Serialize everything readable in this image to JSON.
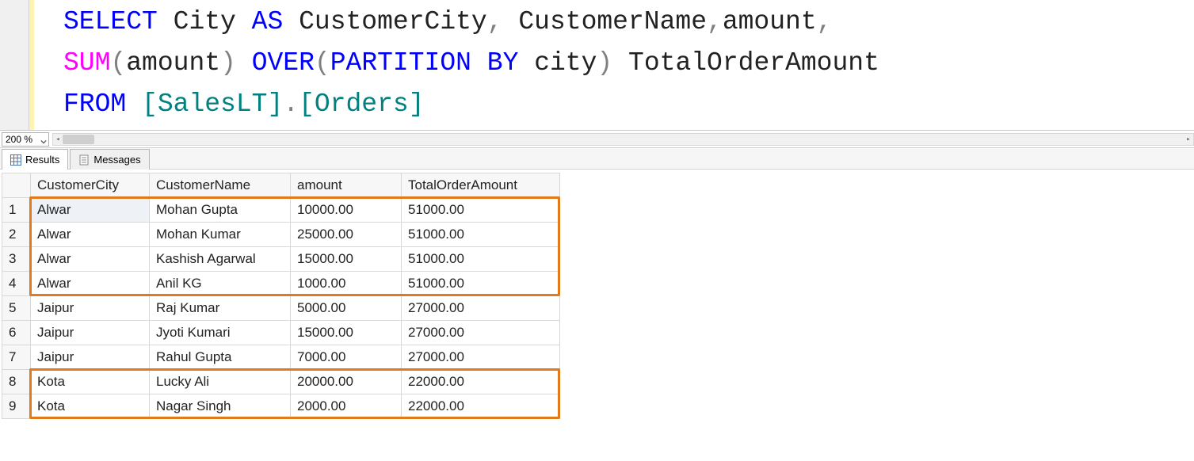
{
  "editor": {
    "tokens": [
      [
        {
          "t": "SELECT",
          "c": "kw-blue"
        },
        {
          "t": " ",
          "c": ""
        },
        {
          "t": "City",
          "c": "ident"
        },
        {
          "t": " ",
          "c": ""
        },
        {
          "t": "AS",
          "c": "kw-blue"
        },
        {
          "t": " ",
          "c": ""
        },
        {
          "t": "CustomerCity",
          "c": "ident"
        },
        {
          "t": ",",
          "c": "kw-gray"
        },
        {
          "t": " ",
          "c": ""
        },
        {
          "t": "CustomerName",
          "c": "ident"
        },
        {
          "t": ",",
          "c": "kw-gray"
        },
        {
          "t": "amount",
          "c": "ident"
        },
        {
          "t": ",",
          "c": "kw-gray"
        }
      ],
      [
        {
          "t": "SUM",
          "c": "kw-pink"
        },
        {
          "t": "(",
          "c": "kw-gray"
        },
        {
          "t": "amount",
          "c": "ident"
        },
        {
          "t": ")",
          "c": "kw-gray"
        },
        {
          "t": " ",
          "c": ""
        },
        {
          "t": "OVER",
          "c": "kw-blue"
        },
        {
          "t": "(",
          "c": "kw-gray"
        },
        {
          "t": "PARTITION",
          "c": "kw-blue"
        },
        {
          "t": " ",
          "c": ""
        },
        {
          "t": "BY",
          "c": "kw-blue"
        },
        {
          "t": " ",
          "c": ""
        },
        {
          "t": "city",
          "c": "ident"
        },
        {
          "t": ")",
          "c": "kw-gray"
        },
        {
          "t": " ",
          "c": ""
        },
        {
          "t": "TotalOrderAmount",
          "c": "ident"
        }
      ],
      [
        {
          "t": "FROM",
          "c": "kw-blue"
        },
        {
          "t": " ",
          "c": ""
        },
        {
          "t": "[SalesLT]",
          "c": "kw-teal"
        },
        {
          "t": ".",
          "c": "kw-gray"
        },
        {
          "t": "[Orders]",
          "c": "kw-teal"
        }
      ]
    ]
  },
  "zoom": {
    "value": "200 %"
  },
  "tabs": {
    "results": "Results",
    "messages": "Messages"
  },
  "grid": {
    "columns": [
      "CustomerCity",
      "CustomerName",
      "amount",
      "TotalOrderAmount"
    ],
    "rows": [
      {
        "n": "1",
        "city": "Alwar",
        "name": "Mohan Gupta",
        "amount": "10000.00",
        "total": "51000.00"
      },
      {
        "n": "2",
        "city": "Alwar",
        "name": "Mohan Kumar",
        "amount": "25000.00",
        "total": "51000.00"
      },
      {
        "n": "3",
        "city": "Alwar",
        "name": "Kashish Agarwal",
        "amount": "15000.00",
        "total": "51000.00"
      },
      {
        "n": "4",
        "city": "Alwar",
        "name": "Anil KG",
        "amount": "1000.00",
        "total": "51000.00"
      },
      {
        "n": "5",
        "city": "Jaipur",
        "name": "Raj Kumar",
        "amount": "5000.00",
        "total": "27000.00"
      },
      {
        "n": "6",
        "city": "Jaipur",
        "name": "Jyoti Kumari",
        "amount": "15000.00",
        "total": "27000.00"
      },
      {
        "n": "7",
        "city": "Jaipur",
        "name": "Rahul Gupta",
        "amount": "7000.00",
        "total": "27000.00"
      },
      {
        "n": "8",
        "city": "Kota",
        "name": "Lucky Ali",
        "amount": "20000.00",
        "total": "22000.00"
      },
      {
        "n": "9",
        "city": "Kota",
        "name": "Nagar Singh",
        "amount": "2000.00",
        "total": "22000.00"
      }
    ]
  }
}
